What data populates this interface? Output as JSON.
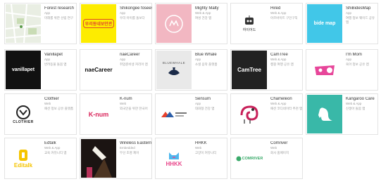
{
  "apps": [
    {
      "name": "Forest research",
      "type": "App",
      "desc": "미래를 위한 산림 연구",
      "icon": "map-thumbnail"
    },
    {
      "name": "Shikongee fosees",
      "type": "App",
      "desc": "우리 아이를 돌보다",
      "icon": "yellow-logo-thumbnail",
      "logo": "우리동네보안관"
    },
    {
      "name": "Mighty Malty",
      "type": "Web & App",
      "desc": "여성 건강 앱",
      "icon": "pink-circle-logo-thumbnail"
    },
    {
      "name": "Hired",
      "type": "Web & App",
      "desc": "아르바이트 구인구직",
      "icon": "robot-logo-thumbnail",
      "logo": "하이어드"
    },
    {
      "name": "ShiBidesMap",
      "type": "App",
      "desc": "여행 정보 웨이드 공유 앱",
      "icon": "map-logo-thumbnail",
      "logo": "bide map"
    },
    {
      "name": "Vanillapet",
      "type": "App",
      "desc": "반려동물 돌봄 앱",
      "icon": "vanillapet-logo-thumbnail",
      "logo": "vanillapet"
    },
    {
      "name": "naeCareer",
      "type": "App",
      "desc": "취업준비생 커리어 앱",
      "icon": "naecareer-logo-thumbnail",
      "logo": "naeCareer"
    },
    {
      "name": "Blue Whale",
      "type": "App",
      "desc": "소셜 음악 플랫폼",
      "icon": "bluewhale-logo-thumbnail",
      "logo": "BLUEWHALE"
    },
    {
      "name": "CamTree",
      "type": "Web & App",
      "desc": "캠핑 여행 공유 앱",
      "icon": "camtree-logo-thumbnail",
      "logo": "CamTree"
    },
    {
      "name": "I'm Mom",
      "type": "App",
      "desc": "육아 정보 공유 앱",
      "icon": "immom-logo-thumbnail"
    },
    {
      "name": "Clothier",
      "type": "Web",
      "desc": "패션 정보 공유 플랫폼",
      "icon": "clothier-logo-thumbnail",
      "logo": "CLOTHIER"
    },
    {
      "name": "K-num",
      "type": "Web",
      "desc": "외국인을 위한 한국어",
      "icon": "knum-logo-thumbnail",
      "logo": "K-num"
    },
    {
      "name": "Sensum",
      "type": "App",
      "desc": "대화형 건강 앱",
      "icon": "sensum-logo-thumbnail"
    },
    {
      "name": "Chameleon",
      "type": "Web & App",
      "desc": "패션 코디네이터 추천 앱",
      "icon": "chameleon-logo-thumbnail"
    },
    {
      "name": "Kangaroo Care",
      "type": "Web & App",
      "desc": "신생아 돌봄 앱",
      "icon": "kangaroo-logo-thumbnail"
    },
    {
      "name": "Edtalk",
      "type": "Web & App",
      "desc": "교육 커뮤니티 앱",
      "icon": "edtalk-logo-thumbnail",
      "logo": "Editalk"
    },
    {
      "name": "Wireless Eastern",
      "type": "Embedded",
      "desc": "무선 조명 제어",
      "icon": "lamp-thumbnail"
    },
    {
      "name": "HHKK",
      "type": "Web",
      "desc": "고양이 커뮤니티",
      "icon": "hhkk-logo-thumbnail",
      "logo": "HHKK"
    },
    {
      "name": "Comriver",
      "type": "Web",
      "desc": "회사 홈페이지",
      "icon": "comriver-logo-thumbnail",
      "logo": "COMRIVER"
    }
  ]
}
